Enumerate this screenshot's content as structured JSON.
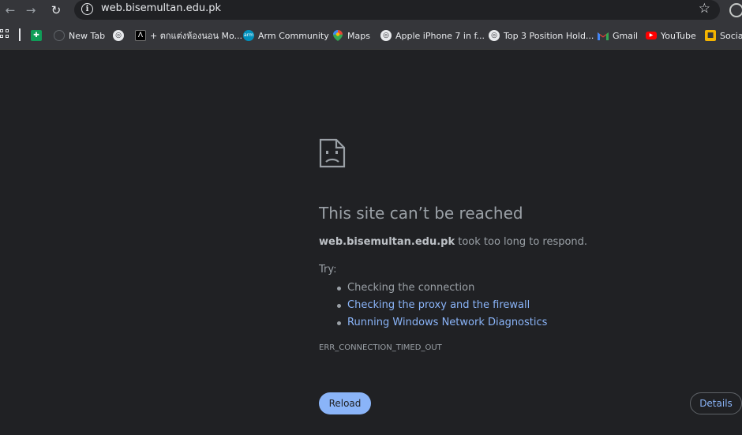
{
  "toolbar": {
    "back_icon": "back-arrow-icon",
    "forward_icon": "forward-arrow-icon",
    "reload_icon": "reload-icon",
    "url": "web.bisemultan.edu.pk",
    "star_icon": "bookmark-star-icon"
  },
  "bookmarks": [
    {
      "label": "",
      "icon": "google-sheets-icon",
      "color": "#0f9d58"
    },
    {
      "label": "New Tab",
      "icon": "new-tab-icon"
    },
    {
      "label": "",
      "icon": "globe-icon"
    },
    {
      "label": "+ ตกแต่งห้องนอน Mo...",
      "icon": "site-icon"
    },
    {
      "label": "Arm Community",
      "icon": "arm-icon",
      "color": "#0091bd"
    },
    {
      "label": "Maps",
      "icon": "maps-icon"
    },
    {
      "label": "Apple iPhone 7 in f...",
      "icon": "globe-icon"
    },
    {
      "label": "Top 3 Position Hold...",
      "icon": "globe-icon"
    },
    {
      "label": "Gmail",
      "icon": "gmail-icon"
    },
    {
      "label": "YouTube",
      "icon": "youtube-icon",
      "color": "#ff0000"
    },
    {
      "label": "Social",
      "icon": "social-icon"
    }
  ],
  "error": {
    "icon": "sad-page-icon",
    "title": "This site can’t be reached",
    "host": "web.bisemultan.edu.pk",
    "message_suffix": " took too long to respond.",
    "try_label": "Try:",
    "suggestions": [
      {
        "text": "Checking the connection",
        "link": false
      },
      {
        "text": "Checking the proxy and the firewall",
        "link": true
      },
      {
        "text": "Running Windows Network Diagnostics",
        "link": true
      }
    ],
    "code": "ERR_CONNECTION_TIMED_OUT",
    "reload_label": "Reload",
    "details_label": "Details"
  },
  "colors": {
    "background": "#202124",
    "toolbar": "#35363a",
    "accent": "#8ab4f8",
    "text": "#9aa0a6"
  }
}
